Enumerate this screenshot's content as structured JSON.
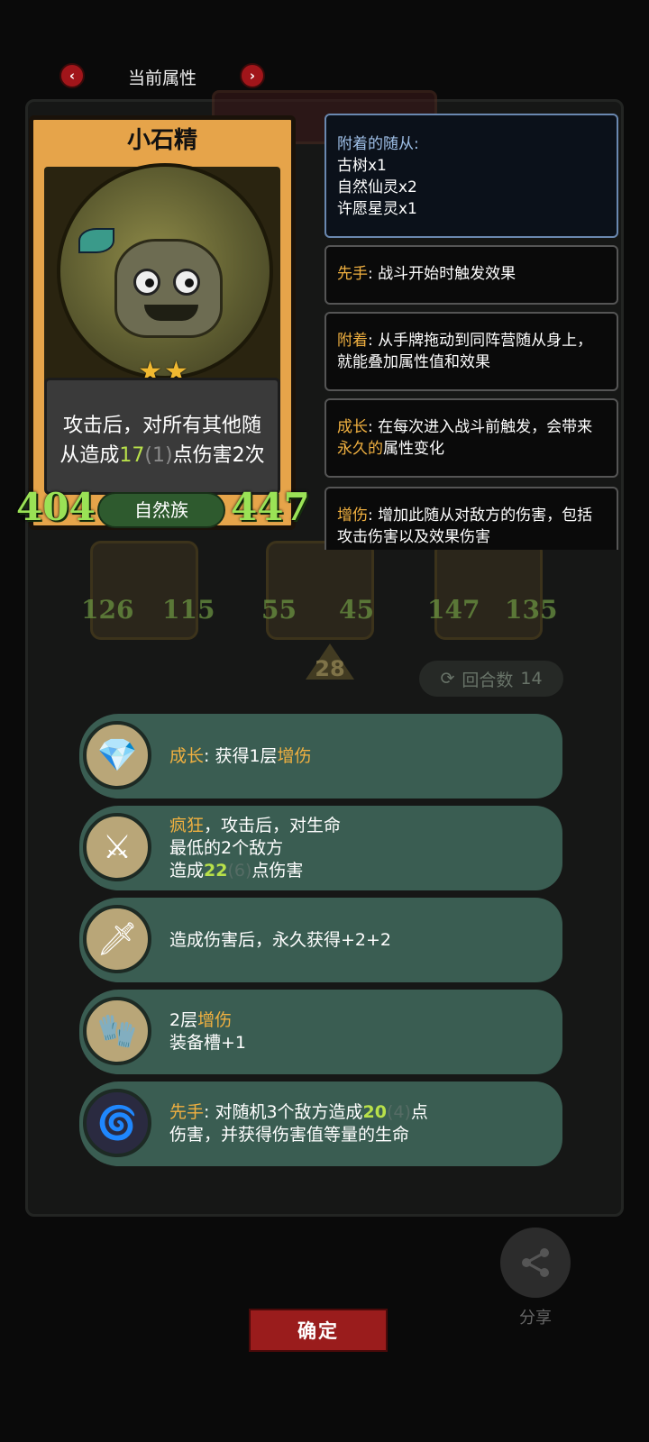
{
  "nav": {
    "title": "当前属性",
    "prev_icon": "chevron-left-icon",
    "next_icon": "chevron-right-icon"
  },
  "background": {
    "round_label": "回合数",
    "round_value": "14",
    "level_value": "28",
    "portraits": [
      {
        "atk": "126",
        "hp": "115"
      },
      {
        "atk": "55",
        "hp": "45"
      },
      {
        "atk": "147",
        "hp": "135"
      }
    ]
  },
  "card": {
    "name": "小石精",
    "stars": "★★",
    "desc_line1": "攻击后，对所有其他随",
    "desc_line2_pre": "从造成",
    "desc_value": "17",
    "desc_extra": "(1)",
    "desc_line2_post": "点伤害2次",
    "attack": "404",
    "health": "447",
    "tribe": "自然族"
  },
  "info_boxes": {
    "attached": {
      "title": "附着的随从:",
      "items": [
        "古树x1",
        "自然仙灵x2",
        "许愿星灵x1"
      ]
    },
    "first_strike": {
      "keyword": "先手",
      "text": ": 战斗开始时触发效果"
    },
    "attach": {
      "keyword": "附着",
      "text": ": 从手牌拖动到同阵营随从身上，就能叠加属性值和效果"
    },
    "growth": {
      "keyword": "成长",
      "text_pre": ": 在每次进入战斗前触发，会带来",
      "highlight": "永久的",
      "text_post": "属性变化"
    },
    "damage_up": {
      "keyword": "增伤",
      "text": ": 增加此随从对敌方的伤害，包括攻击伤害以及效果伤害"
    }
  },
  "skills": [
    {
      "icon": "green-crystal-icon",
      "keyword": "成长",
      "text_pre": ": 获得1层",
      "highlight": "增伤"
    },
    {
      "icon": "scythe-icon",
      "keyword": "疯狂",
      "line1": "，攻击后，对生命",
      "line2": "最低的2个敌方",
      "line3_pre": "造成",
      "value": "22",
      "dim": "(6)",
      "line3_post": "点伤害"
    },
    {
      "icon": "purple-dagger-icon",
      "line1": "造成伤害后，永久获得+2+2"
    },
    {
      "icon": "gauntlet-icon",
      "line1_pre": "2层",
      "highlight": "增伤",
      "line2": "装备槽+1"
    },
    {
      "icon": "purple-blade-icon",
      "keyword": "先手",
      "line1_pre": ": 对随机3个敌方造成",
      "value": "20",
      "dim": "(4)",
      "line1_post": "点",
      "line2": "伤害，并获得伤害值等量的生命"
    }
  ],
  "actions": {
    "share_label": "分享",
    "confirm_label": "确定"
  },
  "colors": {
    "accent_gold": "#f0b040",
    "value_green": "#b8e04a",
    "button_red": "#9a1c1c",
    "skill_bg": "#3a5d52"
  }
}
